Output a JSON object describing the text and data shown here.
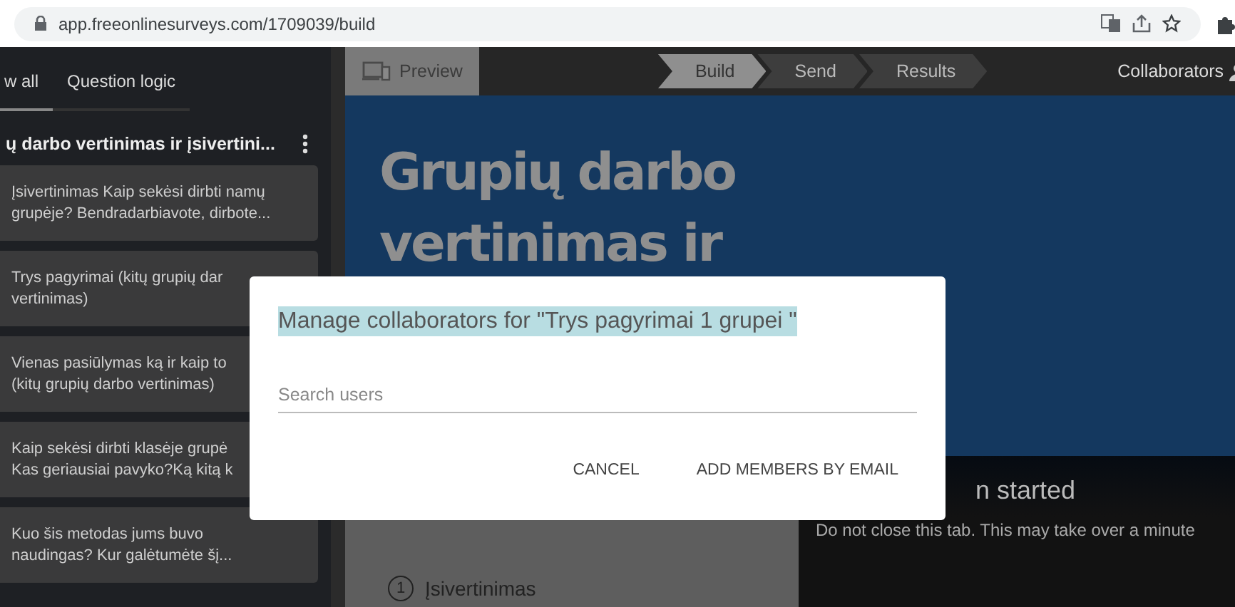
{
  "browser": {
    "url": "app.freeonlinesurveys.com/1709039/build"
  },
  "sidebar": {
    "tabs": [
      {
        "label": "w all",
        "selected": true
      },
      {
        "label": "Question logic",
        "selected": false
      }
    ],
    "survey_title": "ų darbo vertinimas ir įsivertini...",
    "questions": [
      {
        "lines": [
          "Įsivertinimas Kaip sekėsi dirbti namų",
          "grupėje? Bendradarbiavote, dirbote..."
        ]
      },
      {
        "lines": [
          "Trys pagyrimai (kitų grupių dar",
          "vertinimas)"
        ]
      },
      {
        "lines": [
          "Vienas pasiūlymas ką ir kaip to",
          "(kitų grupių darbo vertinimas)"
        ]
      },
      {
        "lines": [
          "Kaip sekėsi dirbti klasėje grupė",
          "Kas geriausiai pavyko?Ką kitą k"
        ]
      },
      {
        "lines": [
          "Kuo šis metodas jums buvo",
          "naudingas? Kur galėtumėte šį..."
        ]
      }
    ]
  },
  "toolbar": {
    "preview": "Preview",
    "steps": [
      {
        "label": "Build",
        "selected": true
      },
      {
        "label": "Send",
        "selected": false
      },
      {
        "label": "Results",
        "selected": false
      }
    ],
    "collaborators": "Collaborators"
  },
  "hero": {
    "title_lines": [
      "Grupių darbo",
      "vertinimas ir"
    ]
  },
  "status_panel": {
    "heading": "n started",
    "message": "Do not close this tab. This may take over a minute"
  },
  "first_question": {
    "number": "1",
    "label": "Įsivertinimas"
  },
  "dialog": {
    "title": "Manage collaborators for \"Trys pagyrimai 1 grupei \"",
    "search": {
      "placeholder": "Search users"
    },
    "buttons": [
      "CANCEL",
      "ADD MEMBERS BY EMAIL"
    ]
  }
}
